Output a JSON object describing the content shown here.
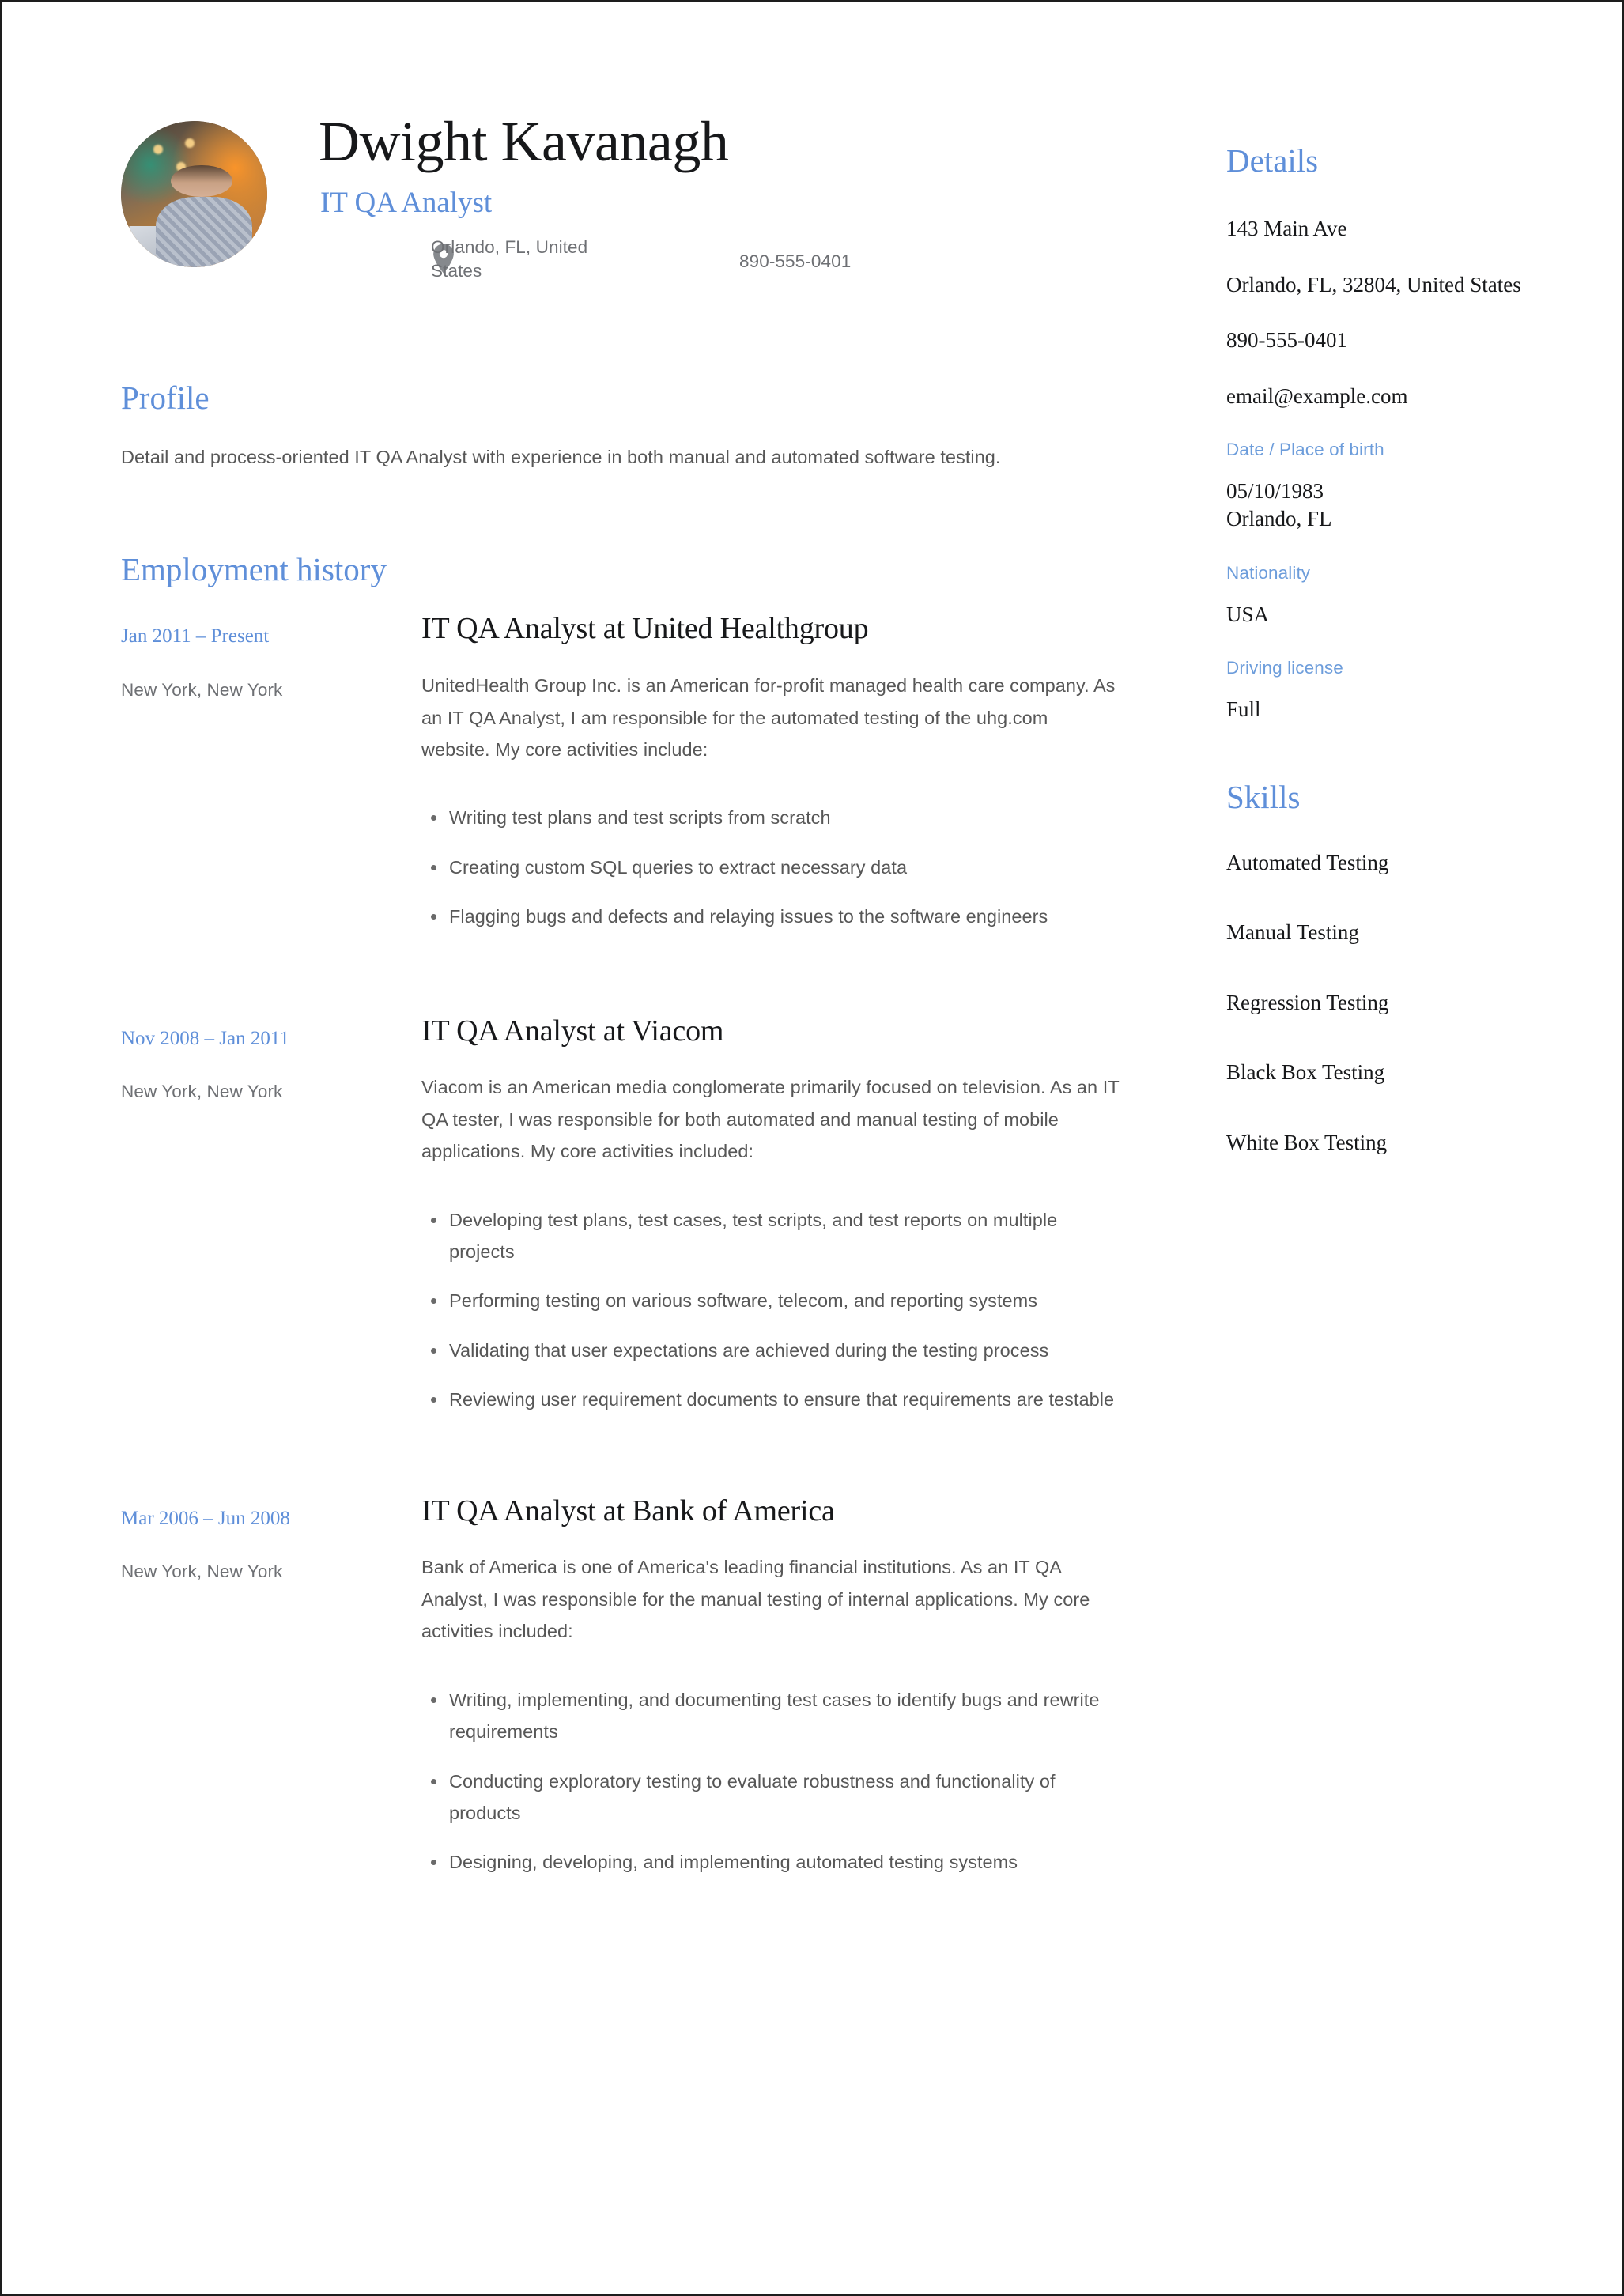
{
  "header": {
    "name": "Dwight Kavanagh",
    "job_title": "IT QA Analyst",
    "location": "Orlando, FL, United States",
    "phone": "890-555-0401",
    "location_icon": "map-pin-icon",
    "avatar_alt": "profile-photo"
  },
  "profile": {
    "heading": "Profile",
    "text": "Detail and process-oriented IT QA Analyst with experience in both manual and automated software testing."
  },
  "employment": {
    "heading": "Employment history",
    "jobs": [
      {
        "date": "Jan 2011 – Present",
        "location": "New York, New York",
        "title": "IT QA Analyst at United Healthgroup",
        "description": "UnitedHealth Group Inc. is an American for-profit managed health care company. As an IT QA Analyst, I am responsible for the automated testing of the uhg.com website. My core activities include:",
        "bullets": [
          "Writing test plans and test scripts from scratch",
          "Creating custom SQL queries to extract necessary data",
          "Flagging bugs and defects and relaying issues to the software engineers"
        ]
      },
      {
        "date": "Nov 2008 – Jan 2011",
        "location": "New York, New York",
        "title": "IT QA Analyst at Viacom",
        "description": "Viacom is an American media conglomerate primarily focused on television. As an IT QA tester, I was responsible for both automated and manual testing of mobile applications. My core activities included:",
        "bullets": [
          "Developing test plans, test cases, test scripts, and test reports on multiple projects",
          "Performing testing on various software, telecom, and reporting systems",
          "Validating that user expectations are achieved during the testing process",
          "Reviewing user requirement documents to ensure that requirements are testable"
        ]
      },
      {
        "date": "Mar 2006 – Jun 2008",
        "location": "New York, New York",
        "title": "IT QA Analyst at Bank of America",
        "description": "Bank of America is one of America's leading financial institutions. As an IT QA Analyst, I was responsible for the manual testing of internal applications. My core activities included:",
        "bullets": [
          "Writing, implementing, and documenting test cases to identify bugs and rewrite requirements",
          "Conducting exploratory testing to evaluate robustness and functionality of products",
          "Designing, developing, and implementing automated testing systems"
        ]
      }
    ]
  },
  "details": {
    "heading": "Details",
    "address_line1": "143 Main Ave",
    "address_line2": "Orlando, FL, 32804, United States",
    "phone": "890-555-0401",
    "email": "email@example.com",
    "dob_label": "Date / Place of birth",
    "dob_value": "05/10/1983\nOrlando, FL",
    "nationality_label": "Nationality",
    "nationality_value": "USA",
    "license_label": "Driving license",
    "license_value": "Full"
  },
  "skills": {
    "heading": "Skills",
    "items": [
      "Automated Testing",
      "Manual Testing",
      "Regression Testing",
      "Black Box Testing",
      "White Box Testing"
    ]
  },
  "colors": {
    "accent_blue": "#5f8fd9",
    "label_blue": "#6d9ddb",
    "body_gray": "#575757",
    "muted_gray": "#6e7074",
    "heading_black": "#17181a"
  }
}
